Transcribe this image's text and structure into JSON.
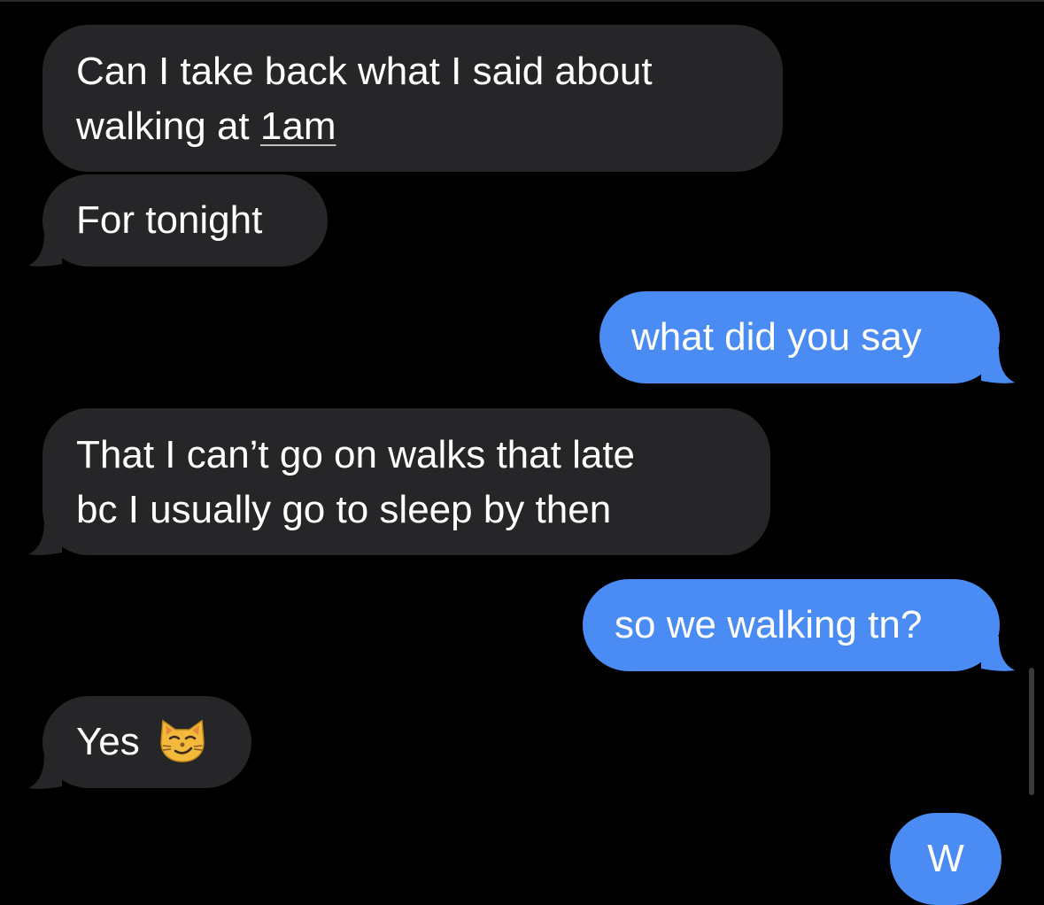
{
  "conversation": {
    "messages": [
      {
        "sender": "them",
        "lines": [
          "Can I take back what I said about",
          "walking at "
        ],
        "link_text": "1am"
      },
      {
        "sender": "them",
        "text": "For tonight"
      },
      {
        "sender": "me",
        "text": "what did you say"
      },
      {
        "sender": "them",
        "lines": [
          "That I can’t go on walks that late",
          "bc I usually go to sleep by then"
        ]
      },
      {
        "sender": "me",
        "text": "so we walking tn?"
      },
      {
        "sender": "them",
        "text": "Yes",
        "emoji": "smirking-cat-emoji"
      },
      {
        "sender": "me",
        "text": "W"
      }
    ]
  },
  "colors": {
    "background": "#000000",
    "incoming_bubble": "#262628",
    "outgoing_bubble": "#4a8cf4",
    "text": "#ffffff"
  }
}
